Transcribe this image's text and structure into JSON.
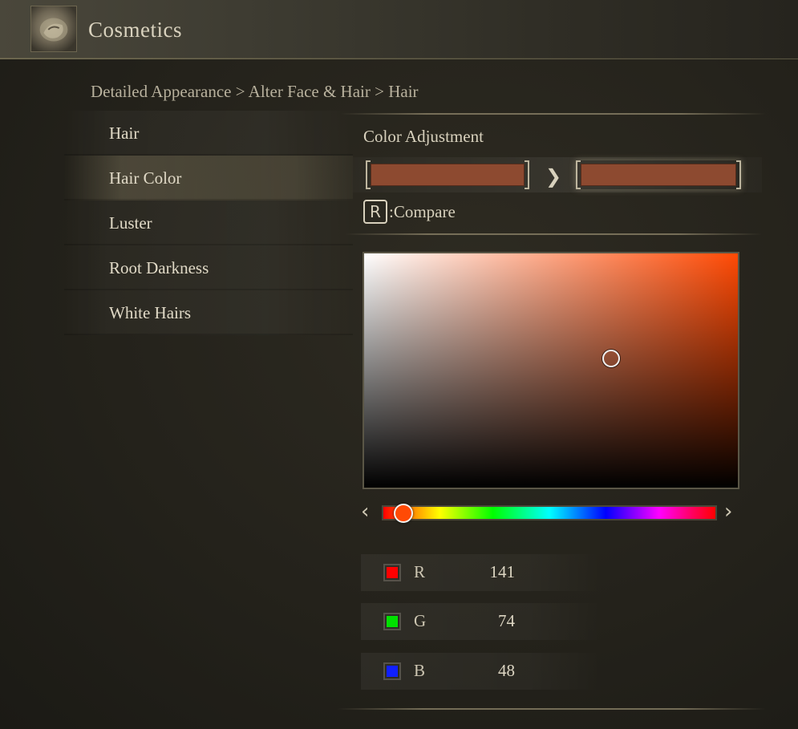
{
  "header": {
    "title": "Cosmetics",
    "icon": "cosmetics-emblem-icon"
  },
  "breadcrumb": "Detailed Appearance > Alter Face & Hair > Hair",
  "menu": {
    "items": [
      {
        "label": "Hair",
        "active": false
      },
      {
        "label": "Hair Color",
        "active": true
      },
      {
        "label": "Luster",
        "active": false
      },
      {
        "label": "Root Darkness",
        "active": false
      },
      {
        "label": "White Hairs",
        "active": false
      }
    ]
  },
  "color_adjustment": {
    "title": "Color Adjustment",
    "before_color": "#8d4a30",
    "after_color": "#8d4a30",
    "compare_key": "R",
    "compare_label": ":Compare",
    "hue_color": "#ff4a05",
    "saturation": 0.66,
    "value": 0.55,
    "hue_position": 0.03
  },
  "rgb": [
    {
      "label": "R",
      "value": "141",
      "chip_color": "#ff0000"
    },
    {
      "label": "G",
      "value": "74",
      "chip_color": "#00e000"
    },
    {
      "label": "B",
      "value": "48",
      "chip_color": "#1020ff"
    }
  ]
}
